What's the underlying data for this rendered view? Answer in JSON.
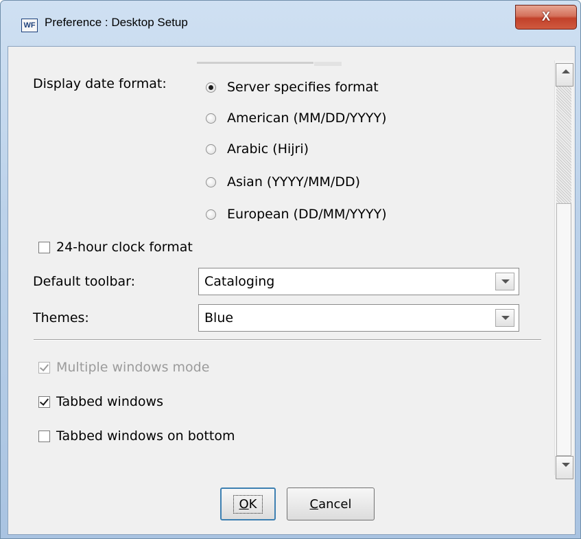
{
  "window": {
    "app_icon_text": "WF",
    "title": "Preference : Desktop Setup",
    "close_symbol": "X"
  },
  "date_format": {
    "label": "Display date format:",
    "options": [
      {
        "label": "Server specifies format",
        "selected": true
      },
      {
        "label": "American (MM/DD/YYYY)",
        "selected": false
      },
      {
        "label": "Arabic (Hijri)",
        "selected": false
      },
      {
        "label": "Asian (YYYY/MM/DD)",
        "selected": false
      },
      {
        "label": "European (DD/MM/YYYY)",
        "selected": false
      }
    ]
  },
  "clock": {
    "label": "24-hour clock format",
    "checked": false
  },
  "toolbar": {
    "label": "Default toolbar:",
    "value": "Cataloging"
  },
  "themes": {
    "label": "Themes:",
    "value": "Blue"
  },
  "windows": {
    "multiple": {
      "label": "Multiple windows mode",
      "checked": true,
      "disabled": true
    },
    "tabbed": {
      "label": "Tabbed windows",
      "checked": true
    },
    "tabbed_bottom": {
      "label": "Tabbed windows on bottom",
      "checked": false
    }
  },
  "buttons": {
    "ok": {
      "underline": "O",
      "rest": "K"
    },
    "cancel": {
      "underline": "C",
      "rest": "ancel"
    }
  },
  "icons": {
    "app": "app-logo-icon",
    "close": "close-icon",
    "dropdown": "chevron-down-icon",
    "scroll_up": "scroll-up-arrow-icon",
    "scroll_down": "scroll-down-arrow-icon"
  },
  "colors": {
    "titlebar": "#bcd2ea",
    "close": "#c2412a",
    "dialog": "#f0f0f0",
    "default_button_border": "#3c7fb1"
  }
}
